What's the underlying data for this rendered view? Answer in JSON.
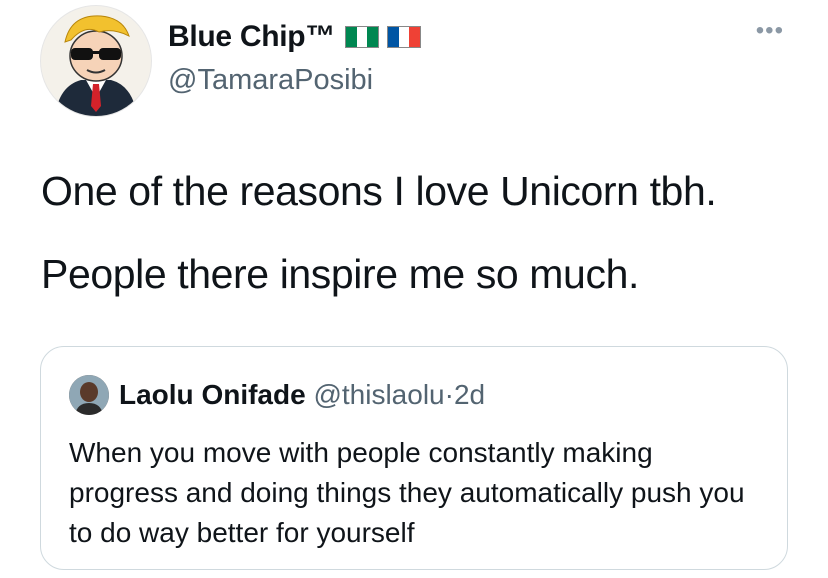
{
  "tweet": {
    "author": {
      "display_name": "Blue Chip™",
      "handle": "@TamaraPosibi",
      "avatar_icon": "wallstreetbets-mascot-avatar",
      "flags": [
        "nigeria-flag",
        "france-flag"
      ]
    },
    "more_icon": "more-dots-icon",
    "text": [
      "One of the reasons I love Unicorn tbh.",
      "People there inspire me so much."
    ]
  },
  "quote": {
    "author": {
      "display_name": "Laolu Onifade",
      "handle": "@thislaolu",
      "separator": "·",
      "time": "2d"
    },
    "text": "When you move with people constantly making progress and doing things they automatically push you to do way better for yourself"
  },
  "colors": {
    "secondary_text": "#536471",
    "border": "#cfd9de",
    "nigeria_green": "#008751",
    "france_blue": "#0055a4",
    "france_red": "#ef4135"
  }
}
